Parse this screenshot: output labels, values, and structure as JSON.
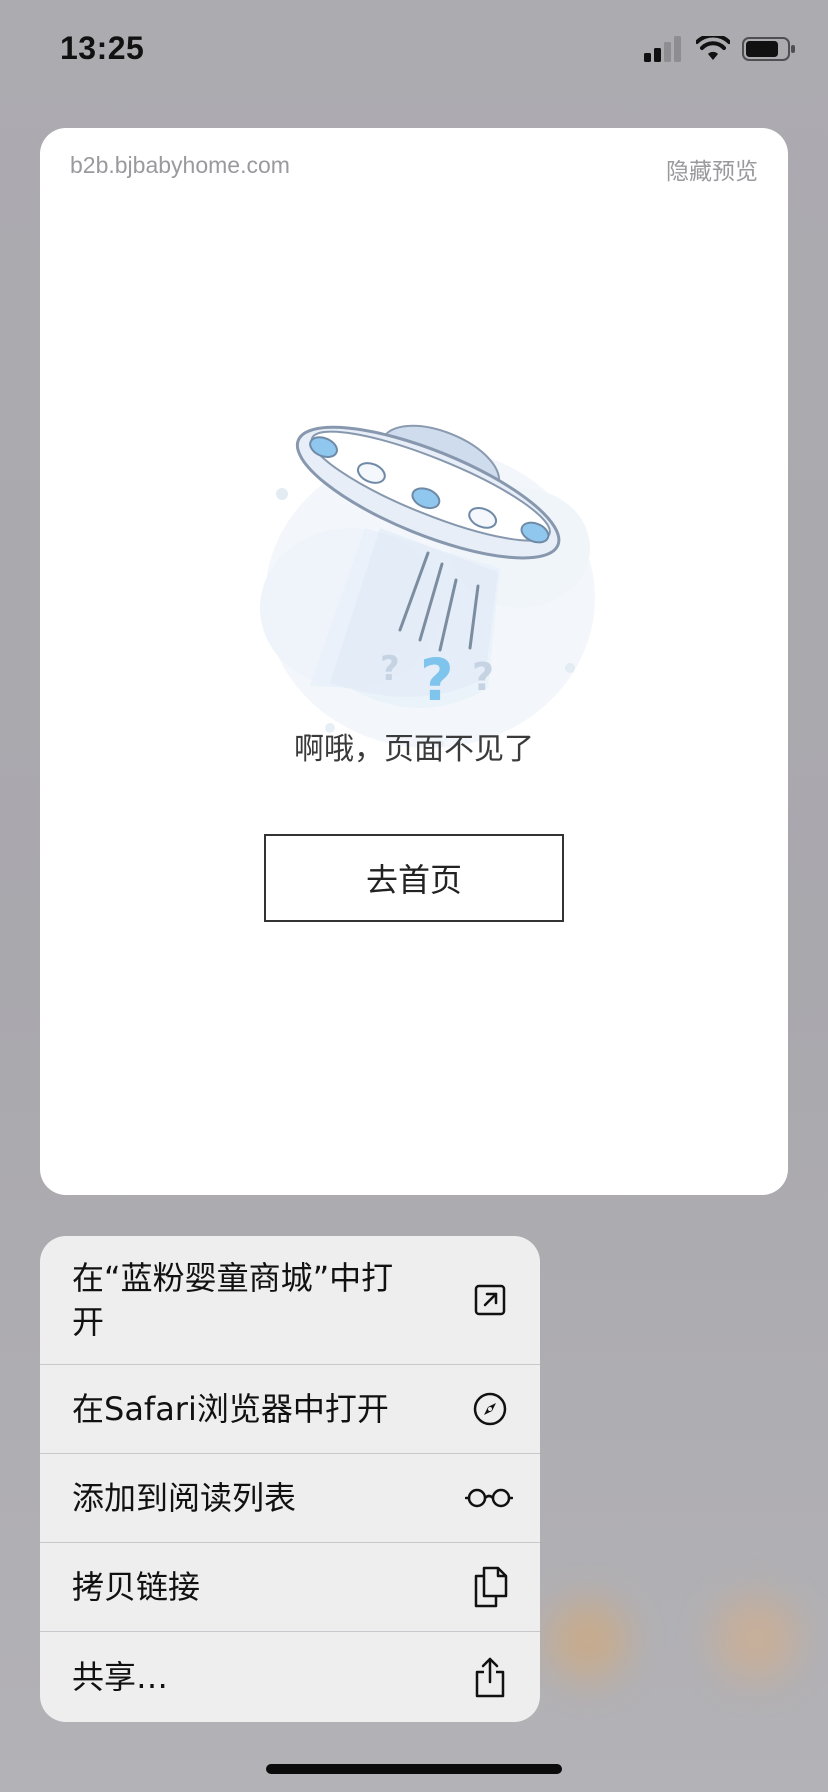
{
  "status_bar": {
    "time": "13:25"
  },
  "preview": {
    "url": "b2b.bjbabyhome.com",
    "hide_preview_label": "隐藏预览",
    "error_message": "啊哦，页面不见了",
    "home_button_label": "去首页"
  },
  "context_menu": {
    "items": [
      {
        "label": "在“蓝粉婴童商城”中打开",
        "icon": "open-in-app-icon"
      },
      {
        "label": "在Safari浏览器中打开",
        "icon": "compass-icon"
      },
      {
        "label": "添加到阅读列表",
        "icon": "glasses-icon"
      },
      {
        "label": "拷贝链接",
        "icon": "copy-icon"
      },
      {
        "label": "共享…",
        "icon": "share-icon"
      }
    ]
  },
  "colors": {
    "accent_ufo": "#8fc7ee",
    "menu_background": "#eeeeef"
  }
}
